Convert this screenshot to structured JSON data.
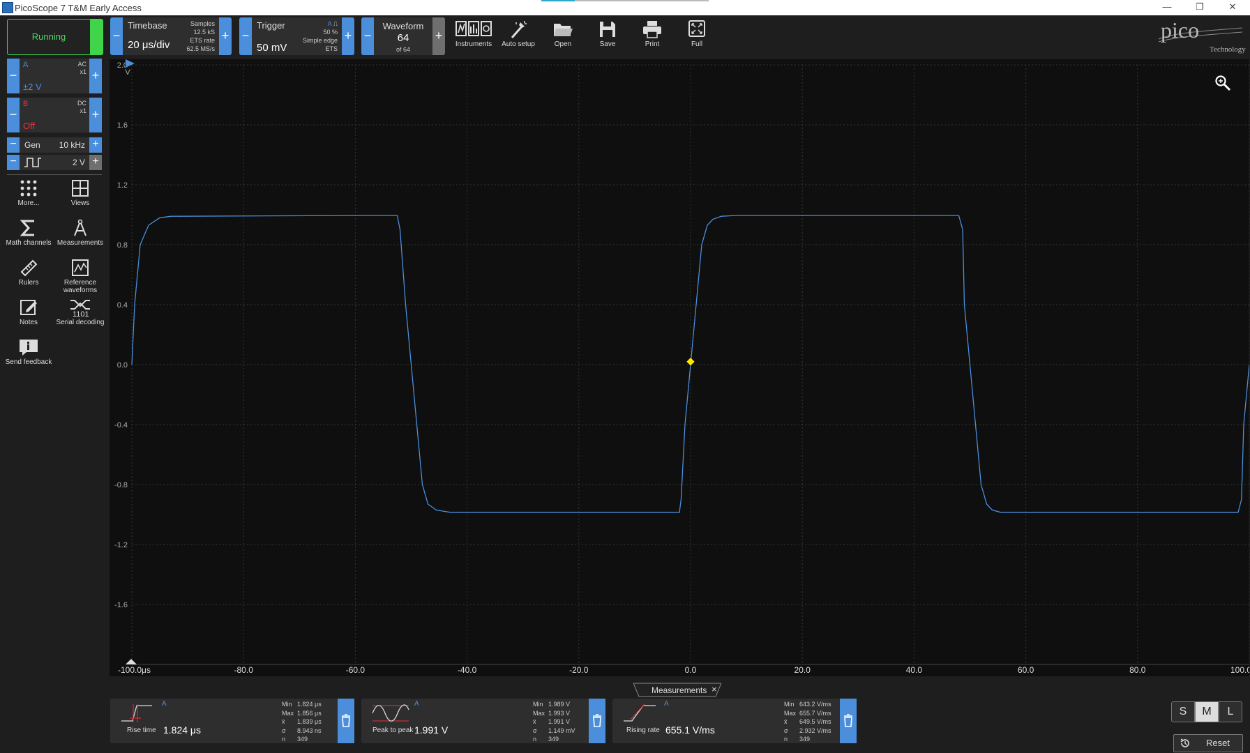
{
  "window": {
    "title": "PicoScope 7 T&M Early Access",
    "min_glyph": "—",
    "restore_glyph": "❐",
    "close_glyph": "✕"
  },
  "status": {
    "label": "Running"
  },
  "timebase": {
    "title": "Timebase",
    "value": "20 μs/div",
    "samples_label": "Samples",
    "samples_value": "12.5 kS",
    "rate_label": "ETS rate",
    "rate_value": "62.5 MS/s"
  },
  "trigger": {
    "title": "Trigger",
    "value": "50 mV",
    "channel": "A",
    "level": "50 %",
    "type": "Simple edge",
    "mode": "ETS"
  },
  "waveform": {
    "title": "Waveform",
    "value": "64",
    "of": "of 64"
  },
  "tools": [
    {
      "label": "Instruments"
    },
    {
      "label": "Auto setup"
    },
    {
      "label": "Open"
    },
    {
      "label": "Save"
    },
    {
      "label": "Print"
    },
    {
      "label": "Full"
    }
  ],
  "logo": {
    "word": "pico",
    "sub": "Technology"
  },
  "channels": {
    "a": {
      "name": "A",
      "coupling": "AC",
      "probe": "x1",
      "range": "±2 V",
      "color": "#4b8fdc"
    },
    "b": {
      "name": "B",
      "coupling": "DC",
      "probe": "x1",
      "range": "Off",
      "color": "#e8303a"
    }
  },
  "gen": {
    "label": "Gen",
    "freq": "10 kHz",
    "amp": "2 V"
  },
  "left_buttons": [
    {
      "label": "More..."
    },
    {
      "label": "Views"
    },
    {
      "label": "Math channels"
    },
    {
      "label": "Measurements"
    },
    {
      "label": "Rulers"
    },
    {
      "label": "Reference waveforms"
    },
    {
      "label": "Notes"
    },
    {
      "label": "Serial decoding"
    },
    {
      "label": "Send feedback"
    }
  ],
  "minus": "−",
  "plus": "+",
  "chart_data": {
    "type": "line",
    "x_ticks": [
      "-100.0μs",
      "-80.0",
      "-60.0",
      "-40.0",
      "-20.0",
      "0.0",
      "20.0",
      "40.0",
      "60.0",
      "80.0",
      "100.0"
    ],
    "y_ticks": [
      "2.0",
      "1.6",
      "1.2",
      "0.8",
      "0.4",
      "0.0",
      "-0.4",
      "-0.8",
      "-1.2",
      "-1.6"
    ],
    "y_unit": "V",
    "xlim": [
      -100,
      100
    ],
    "ylim": [
      -2.0,
      2.0
    ],
    "grid": true,
    "series": [
      {
        "color": "#4b8fdc",
        "x": [
          -100,
          -99.5,
          -98.5,
          -97,
          -95,
          -93,
          -60,
          -52.5,
          -52,
          -51,
          -50,
          -49,
          -48,
          -47,
          -45.5,
          -43,
          -2,
          -1.7,
          -1.0,
          0,
          1,
          2,
          3,
          4,
          5.5,
          8,
          48,
          48.7,
          49,
          50,
          51,
          52,
          53,
          54,
          55.5,
          58,
          98,
          98.6,
          99,
          100
        ],
        "y": [
          0,
          0.4,
          0.8,
          0.93,
          0.98,
          0.99,
          0.995,
          0.995,
          0.9,
          0.4,
          0.0,
          -0.4,
          -0.8,
          -0.93,
          -0.97,
          -0.985,
          -0.985,
          -0.9,
          -0.4,
          0.0,
          0.4,
          0.8,
          0.93,
          0.97,
          0.99,
          0.995,
          0.995,
          0.9,
          0.4,
          0.0,
          -0.4,
          -0.8,
          -0.93,
          -0.97,
          -0.985,
          -0.985,
          -0.985,
          -0.9,
          -0.4,
          0.0
        ]
      }
    ],
    "trigger_marker": {
      "x": 0,
      "y": 0.02,
      "color": "#ffe600"
    }
  },
  "measurements": {
    "tab_label": "Measurements",
    "tab_close": "×",
    "items": [
      {
        "name": "Rise time",
        "channel": "A",
        "value": "1.824 μs",
        "min": "1.824 μs",
        "max": "1.856 μs",
        "mean": "1.839 μs",
        "sd": "8.943 ns",
        "n": "349"
      },
      {
        "name": "Peak to peak",
        "channel": "A",
        "value": "1.991 V",
        "min": "1.989 V",
        "max": "1.993 V",
        "mean": "1.991 V",
        "sd": "1.149 mV",
        "n": "349"
      },
      {
        "name": "Rising rate",
        "channel": "A",
        "value": "655.1 V/ms",
        "min": "643.2 V/ms",
        "max": "655.7 V/ms",
        "mean": "649.5 V/ms",
        "sd": "2.932 V/ms",
        "n": "349"
      }
    ],
    "stat_labels": {
      "min": "Min",
      "max": "Max",
      "mean": "x̄",
      "sd": "σ",
      "n": "n"
    }
  },
  "size_buttons": [
    {
      "label": "S"
    },
    {
      "label": "M"
    },
    {
      "label": "L"
    }
  ],
  "reset": {
    "label": "Reset"
  }
}
